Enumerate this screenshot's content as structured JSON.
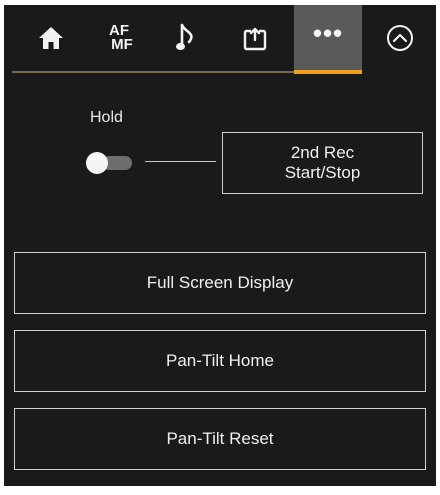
{
  "tabs": [
    {
      "name": "home",
      "icon": "home-icon"
    },
    {
      "name": "af-mf",
      "icon": "af-mf-icon",
      "label_top": "AF",
      "label_bottom": "MF"
    },
    {
      "name": "audio",
      "icon": "music-note-icon"
    },
    {
      "name": "assign",
      "icon": "assign-icon"
    },
    {
      "name": "more",
      "icon": "more-icon",
      "label": "•••",
      "selected": true
    },
    {
      "name": "collapse",
      "icon": "chevron-up-circle-icon"
    }
  ],
  "hold": {
    "label": "Hold",
    "state": "off"
  },
  "buttons": {
    "second_rec_line1": "2nd Rec",
    "second_rec_line2": "Start/Stop",
    "full_screen": "Full Screen Display",
    "pan_tilt_home": "Pan-Tilt Home",
    "pan_tilt_reset": "Pan-Tilt Reset"
  },
  "colors": {
    "background": "#1a1a1a",
    "accent": "#f0a020",
    "selected_tab": "#5a5a5a",
    "border": "#cfcfcf",
    "text": "#f0f0f0"
  }
}
